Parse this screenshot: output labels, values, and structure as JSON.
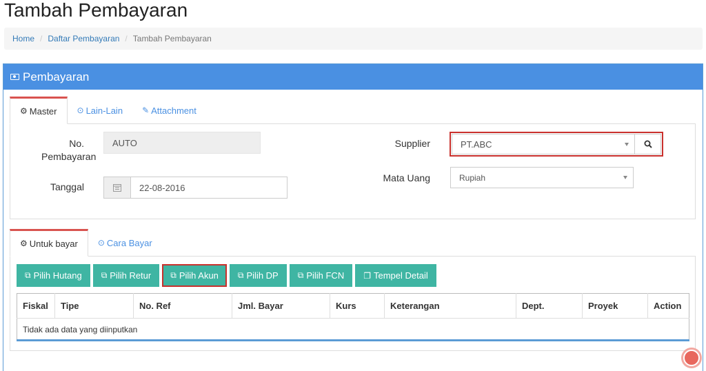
{
  "page": {
    "title": "Tambah Pembayaran"
  },
  "breadcrumb": {
    "home": "Home",
    "list": "Daftar Pembayaran",
    "current": "Tambah Pembayaran",
    "separator": "/"
  },
  "panel": {
    "title": "Pembayaran",
    "icon": "money-icon"
  },
  "top_tabs": [
    {
      "label": "Master",
      "icon": "cogs-icon",
      "glyph": "⚙"
    },
    {
      "label": "Lain-Lain",
      "icon": "check-circle-icon",
      "glyph": "⊙"
    },
    {
      "label": "Attachment",
      "icon": "paperclip-icon",
      "glyph": "✎"
    }
  ],
  "form": {
    "no_label_1": "No.",
    "no_label_2": "Pembayaran",
    "no_value": "AUTO",
    "date_label": "Tanggal",
    "date_value": "22-08-2016",
    "supplier_label": "Supplier",
    "supplier_value": "PT.ABC",
    "currency_label": "Mata Uang",
    "currency_value": "Rupiah"
  },
  "bottom_tabs": [
    {
      "label": "Untuk bayar",
      "icon": "cogs-icon",
      "glyph": "⚙"
    },
    {
      "label": "Cara Bayar",
      "icon": "check-circle-icon",
      "glyph": "⊙"
    }
  ],
  "buttons": [
    {
      "label": "Pilih Hutang",
      "glyph": "⧉"
    },
    {
      "label": "Pilih Retur",
      "glyph": "⧉"
    },
    {
      "label": "Pilih Akun",
      "glyph": "⧉"
    },
    {
      "label": "Pilih DP",
      "glyph": "⧉"
    },
    {
      "label": "Pilih FCN",
      "glyph": "⧉"
    },
    {
      "label": "Tempel Detail",
      "glyph": "❐"
    }
  ],
  "table": {
    "columns": [
      "Fiskal",
      "Tipe",
      "No. Ref",
      "Jml. Bayar",
      "Kurs",
      "Keterangan",
      "Dept.",
      "Proyek",
      "Action"
    ],
    "empty_message": "Tidak ada data yang diinputkan"
  },
  "icons": {
    "search": "search-icon",
    "calendar": "calendar-icon",
    "notification": "notification-icon"
  },
  "colors": {
    "panel_header": "#4a90e2",
    "button": "#3fb5a3",
    "highlight": "#c9302c",
    "active_tab_border": "#d9534f"
  }
}
